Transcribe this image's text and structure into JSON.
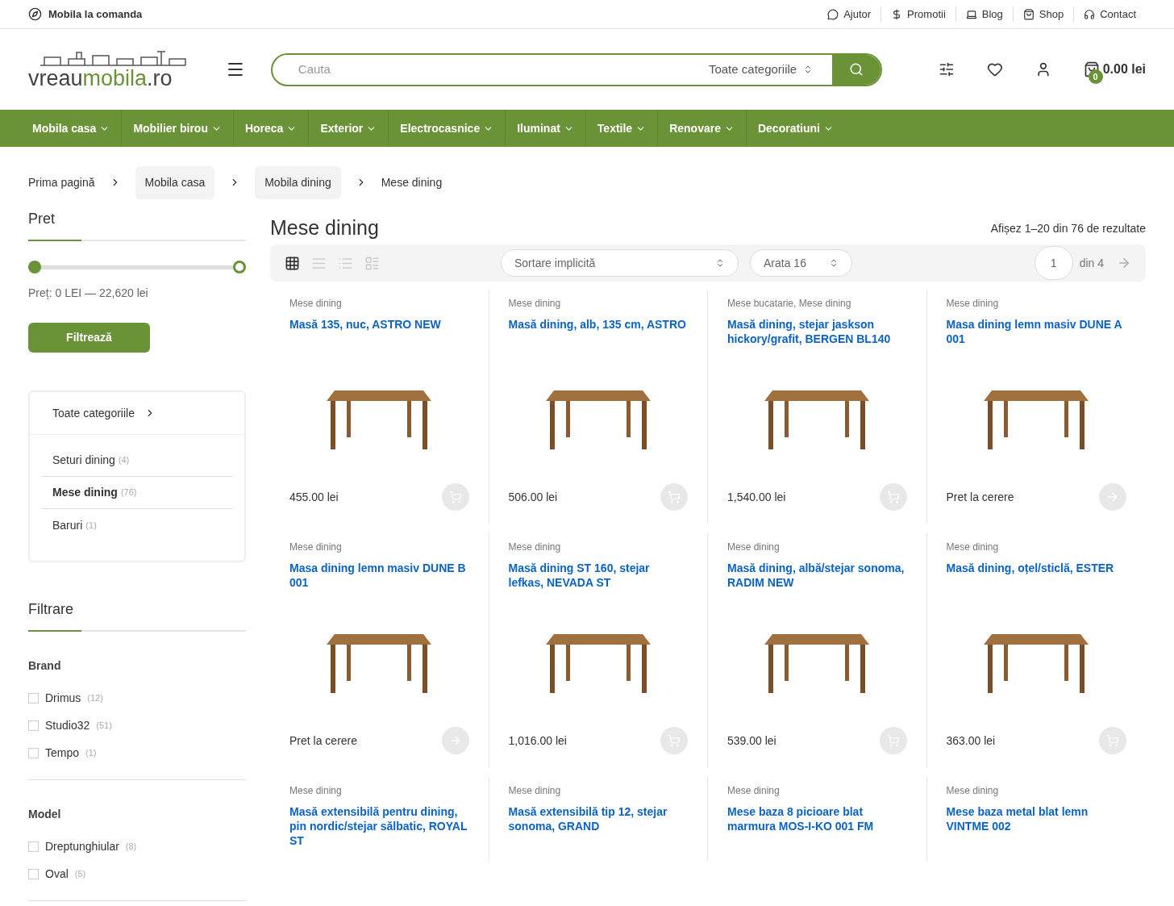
{
  "topbar": {
    "tagline": "Mobila la comanda",
    "links": [
      {
        "kind": "chat",
        "label": "Ajutor"
      },
      {
        "kind": "dollar",
        "label": "Promotii"
      },
      {
        "kind": "laptop",
        "label": "Blog"
      },
      {
        "kind": "bag",
        "label": "Shop"
      },
      {
        "kind": "headset",
        "label": "Contact"
      }
    ]
  },
  "header": {
    "logo": {
      "first": "vreau",
      "second": "mobila",
      "third": ".ro"
    },
    "search": {
      "placeholder": "Cauta",
      "category": "Toate categoriile"
    },
    "cart": {
      "count": "0",
      "total": "0.00 lei"
    }
  },
  "nav": [
    "Mobila casa",
    "Mobilier birou",
    "Horeca",
    "Exterior",
    "Electrocasnice",
    "Iluminat",
    "Textile",
    "Renovare",
    "Decoratiuni"
  ],
  "breadcrumb": [
    {
      "label": "Prima pagină",
      "boxed": false
    },
    {
      "label": "Mobila casa",
      "boxed": true
    },
    {
      "label": "Mobila dining",
      "boxed": true
    },
    {
      "label": "Mese dining",
      "boxed": false
    }
  ],
  "sidebar": {
    "price": {
      "title": "Pret",
      "handles": [
        {
          "level": 0
        },
        {
          "level": 1
        }
      ],
      "reading": "Preț: 0 LEI — 22,620 lei",
      "button": "Filtrează"
    },
    "categories": {
      "all": "Toate categoriile",
      "items": [
        {
          "label": "Seturi dining",
          "count": "(4)",
          "selected": false
        },
        {
          "label": "Mese dining",
          "count": "(76)",
          "selected": true
        },
        {
          "label": "Baruri",
          "count": "(1)",
          "selected": false
        }
      ]
    },
    "filter": {
      "title": "Filtrare",
      "groups": [
        {
          "title": "Brand",
          "options": [
            {
              "label": "Drimus",
              "count": "(12)",
              "checked": false
            },
            {
              "label": "Studio32",
              "count": "(51)",
              "checked": false
            },
            {
              "label": "Tempo",
              "count": "(1)",
              "checked": false
            }
          ]
        },
        {
          "title": "Model",
          "options": [
            {
              "label": "Dreptunghiular",
              "count": "(8)",
              "checked": false
            },
            {
              "label": "Oval",
              "count": "(5)",
              "checked": false
            }
          ]
        }
      ]
    }
  },
  "main": {
    "title": "Mese dining",
    "results": "Afișez 1–20 din 76 de rezultate",
    "views": [
      {
        "kind": "grid",
        "selected": true
      },
      {
        "kind": "list",
        "selected": false
      },
      {
        "kind": "bullets",
        "selected": false
      },
      {
        "kind": "rows",
        "selected": false
      }
    ],
    "sort": "Sortare implicită",
    "perpage": "Arata 16",
    "page": "1",
    "pages": "din 4",
    "products": [
      {
        "category": "Mese dining",
        "title": "Masă 135, nuc, ASTRO NEW",
        "price": "455.00 lei",
        "kind": "cart"
      },
      {
        "category": "Mese dining",
        "title": "Masă dining, alb, 135 cm, ASTRO",
        "price": "506.00 lei",
        "kind": "cart"
      },
      {
        "category": "Mese bucatarie, Mese dining",
        "title": "Masă dining, stejar jaskson hickory/grafit, BERGEN BL140",
        "price": "1,540.00 lei",
        "kind": "cart"
      },
      {
        "category": "Mese dining",
        "title": "Masa dining lemn masiv DUNE A 001",
        "price": "Pret la cerere",
        "kind": "arrow"
      },
      {
        "category": "Mese dining",
        "title": "Masa dining lemn masiv DUNE B 001",
        "price": "Pret la cerere",
        "kind": "arrow"
      },
      {
        "category": "Mese dining",
        "title": "Masă dining ST 160, stejar lefkas, NEVADA ST",
        "price": "1,016.00 lei",
        "kind": "cart"
      },
      {
        "category": "Mese dining",
        "title": "Masă dining, albă/stejar sonoma, RADIM NEW",
        "price": "539.00 lei",
        "kind": "cart"
      },
      {
        "category": "Mese dining",
        "title": "Masă dining, oțel/sticlă, ESTER",
        "price": "363.00 lei",
        "kind": "cart"
      },
      {
        "category": "Mese dining",
        "title": "Masă extensibilă pentru dining, pin nordic/stejar sălbatic, ROYAL ST"
      },
      {
        "category": "Mese dining",
        "title": "Masă extensibilă tip 12, stejar sonoma, GRAND"
      },
      {
        "category": "Mese dining",
        "title": "Mese baza 8 picioare blat marmura MOS-I-KO 001 FM"
      },
      {
        "category": "Mese dining",
        "title": "Mese baza metal blat lemn VINTME 002"
      }
    ]
  }
}
